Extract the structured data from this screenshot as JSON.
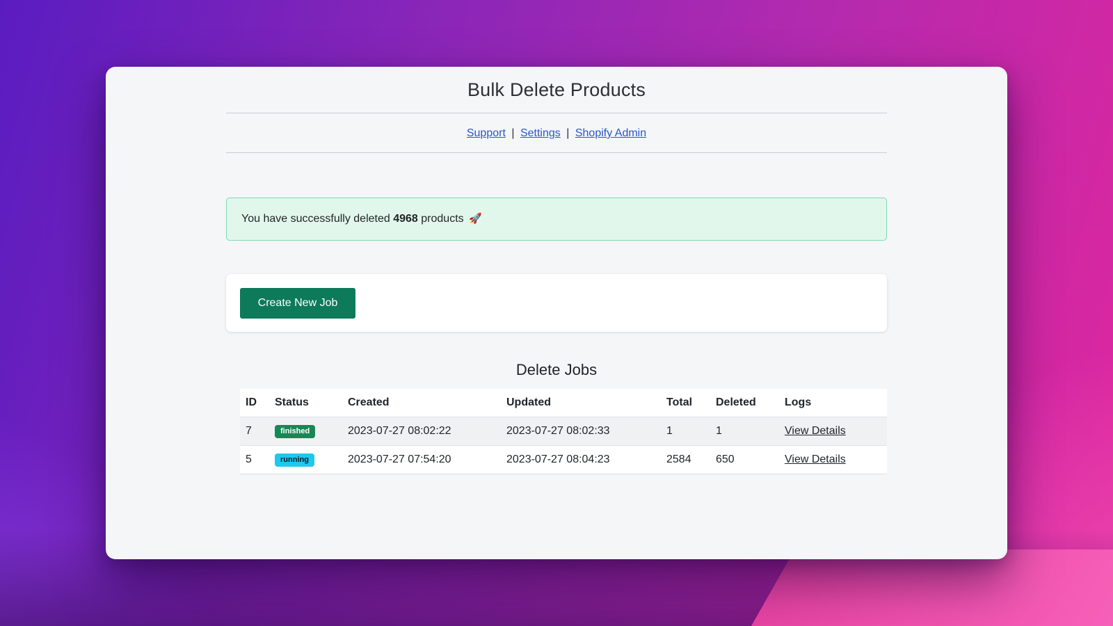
{
  "app": {
    "title": "Bulk Delete Products"
  },
  "nav": {
    "links": [
      {
        "label": "Support"
      },
      {
        "label": "Settings"
      },
      {
        "label": "Shopify Admin"
      }
    ],
    "separator": "|"
  },
  "banner": {
    "prefix": "You have successfully deleted",
    "count": "4968",
    "suffix": "products",
    "icon": "rocket-icon",
    "icon_glyph": "🚀"
  },
  "actions": {
    "create_label": "Create New Job"
  },
  "jobs": {
    "title": "Delete Jobs",
    "columns": [
      "ID",
      "Status",
      "Created",
      "Updated",
      "Total",
      "Deleted",
      "Logs"
    ],
    "rows": [
      {
        "id": "7",
        "status": "finished",
        "created": "2023-07-27 08:02:22",
        "updated": "2023-07-27 08:02:33",
        "total": "1",
        "deleted": "1",
        "logs": "View Details"
      },
      {
        "id": "5",
        "status": "running",
        "created": "2023-07-27 07:54:20",
        "updated": "2023-07-27 08:04:23",
        "total": "2584",
        "deleted": "650",
        "logs": "View Details"
      }
    ]
  },
  "colors": {
    "primary_button": "#0d7a5a",
    "status_finished": "#198754",
    "status_running": "#1ec8ee",
    "banner_background": "#e2f7eb",
    "banner_border": "#7ed9b1",
    "link": "#2757c9"
  }
}
